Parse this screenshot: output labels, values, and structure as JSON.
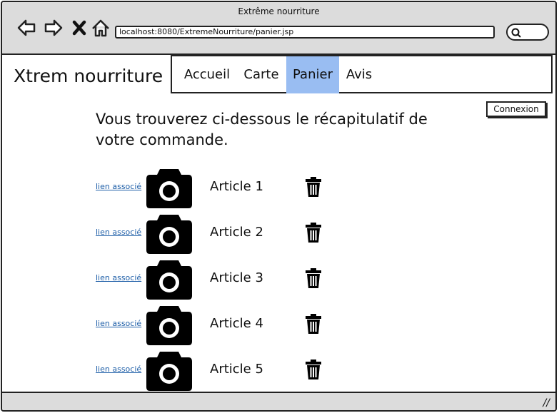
{
  "browser": {
    "window_title": "Extrême nourriture",
    "url": "localhost:8080/ExtremeNourriture/panier.jsp"
  },
  "site": {
    "brand": "Xtrem nourriture",
    "nav": [
      {
        "label": "Accueil",
        "active": false
      },
      {
        "label": "Carte",
        "active": false
      },
      {
        "label": "Panier",
        "active": true
      },
      {
        "label": "Avis",
        "active": false
      }
    ],
    "login_label": "Connexion",
    "active_color": "#99bdf2"
  },
  "cart": {
    "intro": "Vous trouverez ci-dessous le récapitulatif de votre commande.",
    "items": [
      {
        "link": "lien associé",
        "name": "Article 1"
      },
      {
        "link": "lien associé",
        "name": "Article 2"
      },
      {
        "link": "lien associé",
        "name": "Article 3"
      },
      {
        "link": "lien associé",
        "name": "Article 4"
      },
      {
        "link": "lien associé",
        "name": "Article 5"
      }
    ]
  },
  "icons": {
    "back": "back-arrow-icon",
    "forward": "forward-arrow-icon",
    "close": "close-icon",
    "home": "home-icon",
    "search": "search-icon",
    "camera": "camera-icon",
    "trash": "trash-icon"
  }
}
